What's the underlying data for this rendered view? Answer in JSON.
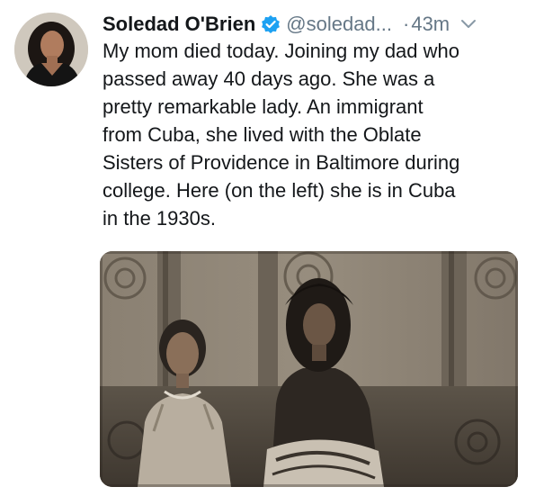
{
  "tweet": {
    "author": {
      "display_name": "Soledad O'Brien",
      "handle": "@soledad...",
      "verified_icon": "verified-badge-icon",
      "avatar_icon": "avatar"
    },
    "separator": "·",
    "timestamp": "43m",
    "menu_icon": "chevron-down-icon",
    "text_lines": [
      "My mom died today. Joining my dad who",
      "passed away 40 days ago. She was a",
      "pretty remarkable lady. An immigrant",
      "from Cuba, she lived with the Oblate",
      "Sisters of Providence in Baltimore during",
      "college. Here (on the left) she is in Cuba",
      "in the 1930s."
    ],
    "media": {
      "kind": "photo",
      "colors": {
        "sepia_dark": "#3b342c",
        "sepia_mid": "#7d7366",
        "sepia_light": "#b5ab9c"
      }
    }
  },
  "colors": {
    "text_primary": "#14171a",
    "text_secondary": "#657786",
    "verified_blue": "#1da1f2"
  }
}
